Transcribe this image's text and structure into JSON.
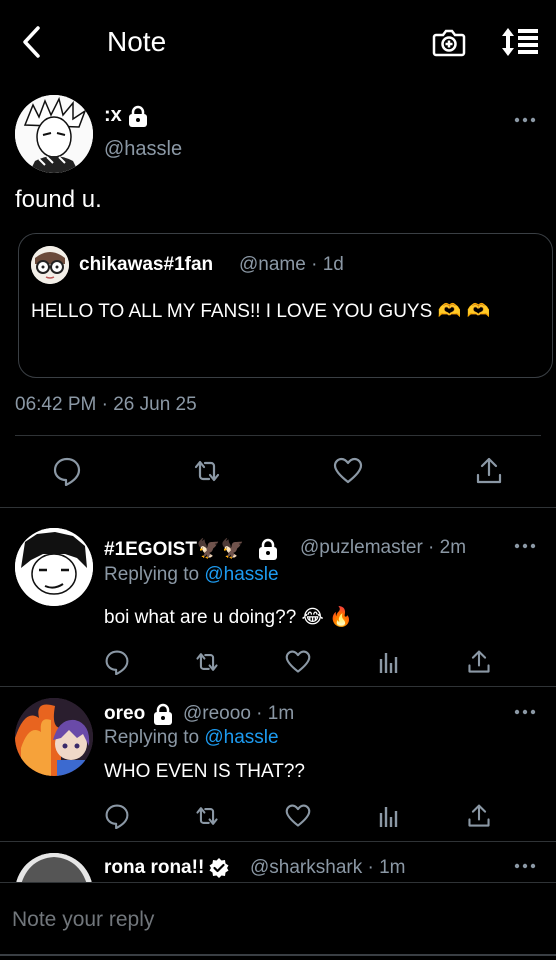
{
  "header": {
    "title": "Note",
    "back_icon": "chevron-left-icon",
    "camera_icon": "camera-plus-icon",
    "sort_icon": "sort-list-icon"
  },
  "main_post": {
    "name": ":x",
    "handle": "@hassle",
    "text": "found u.",
    "timestamp": "06:42 PM · 26 Jun 25",
    "quote": {
      "name": "chikawas#1fan",
      "meta": "@name · 1d",
      "text": "HELLO TO ALL MY FANS!! I LOVE YOU GUYS 🫶 🫶"
    }
  },
  "replies": [
    {
      "name": "#1EGOIST🦅🦅",
      "meta": "@puzlemaster · 2m",
      "replying_prefix": "Replying to ",
      "replying_to": "@hassle",
      "text": "boi what are u doing?? 😂 🔥"
    },
    {
      "name": "oreo",
      "meta": "@reooo · 1m",
      "replying_prefix": "Replying to ",
      "replying_to": "@hassle",
      "text": "WHO EVEN IS THAT??"
    },
    {
      "name": "rona rona!!",
      "meta": "@sharkshark · 1m"
    }
  ],
  "composer": {
    "placeholder": "Note your reply"
  },
  "colors": {
    "background": "#000000",
    "text": "#e7e9ea",
    "muted": "#8b98a5",
    "accent": "#1d9bf0",
    "divider": "#2f3336"
  }
}
